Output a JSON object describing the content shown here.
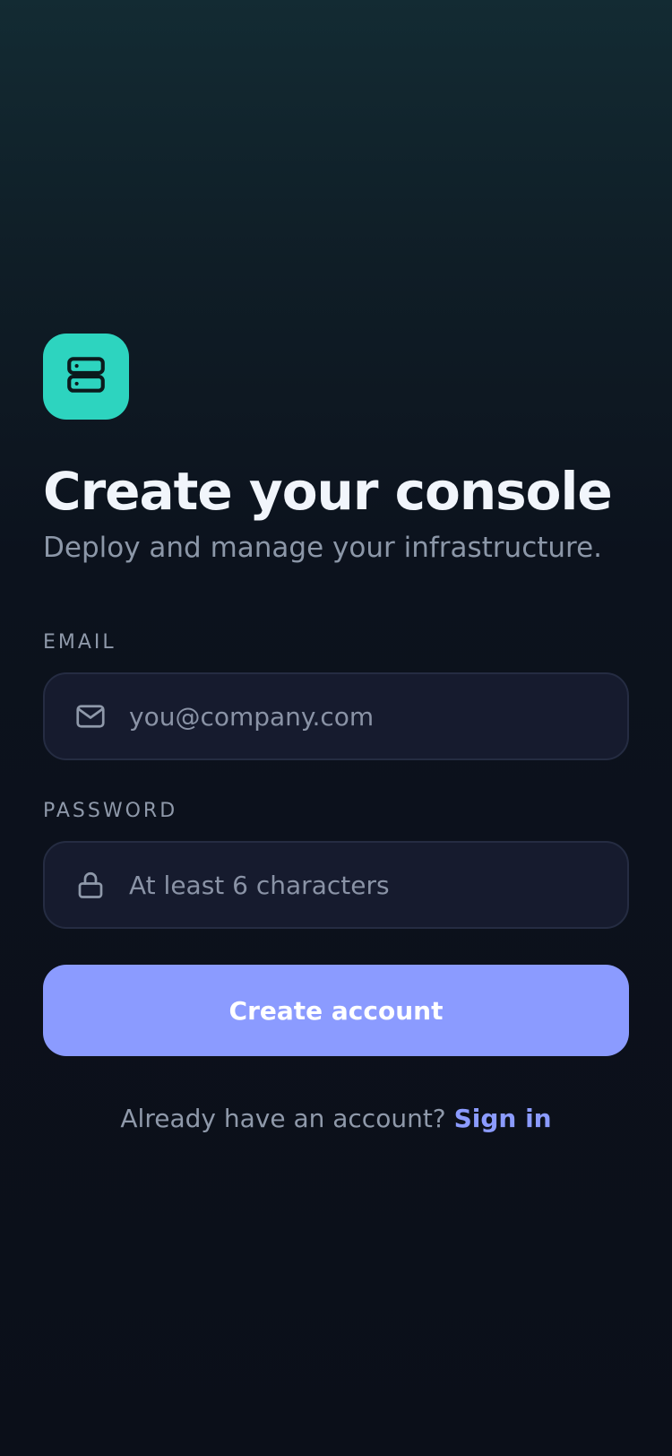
{
  "brand": {
    "logo_icon": "server-icon",
    "accent_color": "#2dd4bf"
  },
  "header": {
    "title": "Create your console",
    "subtitle": "Deploy and manage your infrastructure."
  },
  "form": {
    "email": {
      "label": "EMAIL",
      "icon": "mail-icon",
      "placeholder": "you@company.com",
      "value": ""
    },
    "password": {
      "label": "PASSWORD",
      "icon": "lock-icon",
      "placeholder": "At least 6 characters",
      "value": ""
    },
    "submit_label": "Create account",
    "submit_color": "#8b9bff"
  },
  "footer": {
    "prompt": "Already have an account?",
    "link_label": "Sign in"
  }
}
